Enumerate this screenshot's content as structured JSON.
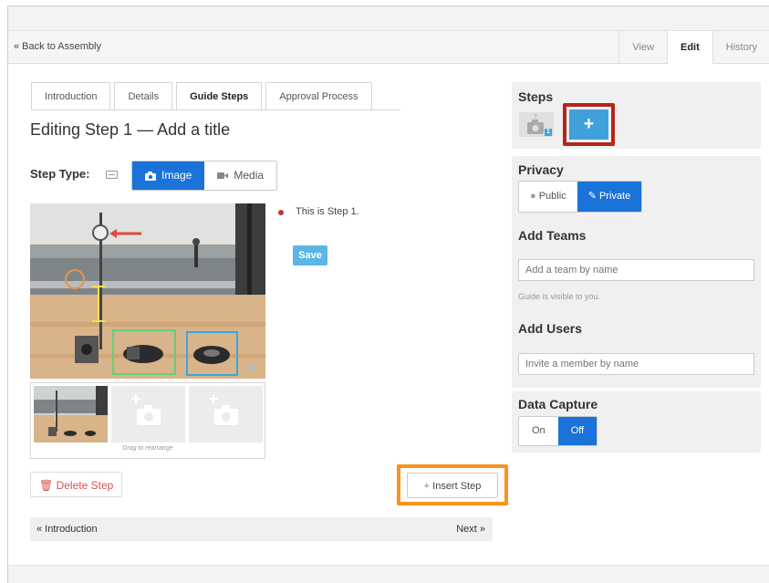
{
  "nav": {
    "back_label": "« Back to Assembly",
    "tabs": [
      {
        "label": "View"
      },
      {
        "label": "Edit"
      },
      {
        "label": "History"
      }
    ]
  },
  "editor": {
    "tabs": [
      {
        "label": "Introduction"
      },
      {
        "label": "Details"
      },
      {
        "label": "Guide Steps"
      },
      {
        "label": "Approval Process"
      }
    ],
    "active_tab": "Guide Steps",
    "title": "Editing Step 1 — Add a title",
    "step_type_label": "Step Type:",
    "type_options": [
      {
        "label": "Image",
        "icon": "camera-icon"
      },
      {
        "label": "Media",
        "icon": "video-camera-icon"
      }
    ],
    "selected_type": "Image",
    "bullet_text": "This is Step 1.",
    "save_label": "Save",
    "drag_hint": "Drag to rearrange",
    "delete_label": "Delete Step",
    "insert_label": "Insert Step",
    "prev_label": "« Introduction",
    "next_label": "Next »",
    "highlight_colors": {
      "orange": "#f7931e",
      "red": "#b5241c",
      "green": "#5fd17a",
      "blue": "#35a9e0",
      "yellow": "#f5e050"
    }
  },
  "sidebar": {
    "steps": {
      "title": "Steps",
      "step_number": "1",
      "add_label": "+"
    },
    "privacy": {
      "title": "Privacy",
      "options": [
        {
          "label": "Public",
          "icon": "globe-icon"
        },
        {
          "label": "Private",
          "icon": "edit-icon"
        }
      ],
      "selected": "Private",
      "teams_title": "Add Teams",
      "teams_placeholder": "Add a team by name",
      "visibility_note": "Guide is visible to you.",
      "users_title": "Add Users",
      "users_placeholder": "Invite a member by name"
    },
    "data_capture": {
      "title": "Data Capture",
      "on_label": "On",
      "off_label": "Off",
      "selected": "Off"
    }
  },
  "accent_color": "#1a73d9"
}
